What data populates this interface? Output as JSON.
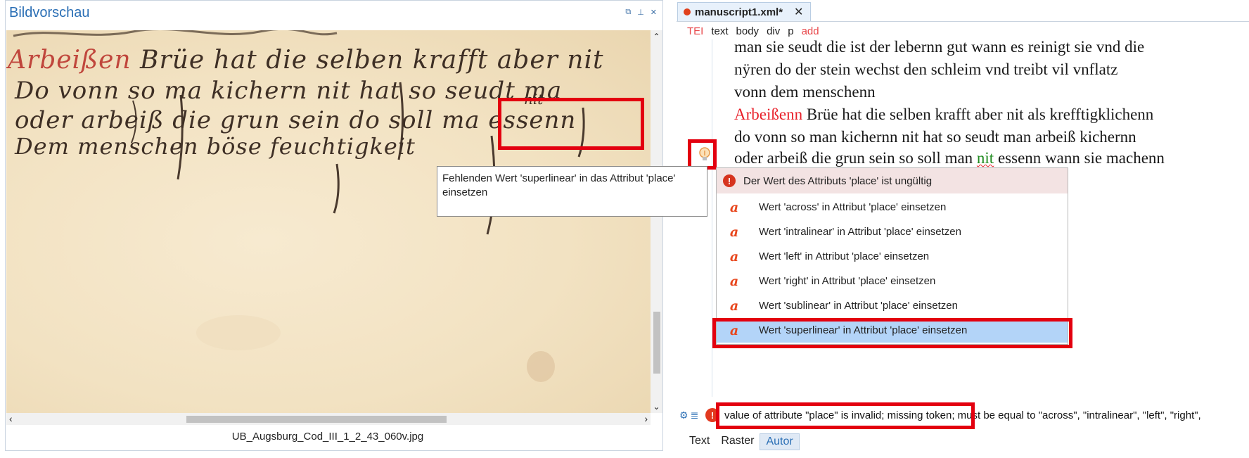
{
  "left_panel": {
    "title": "Bildvorschau",
    "controls": [
      "restore-icon",
      "pin-icon",
      "close-icon"
    ],
    "image_caption": "UB_Augsburg_Cod_III_1_2_43_060v.jpg",
    "manuscript_lines": [
      "Arbeißen Brüe hat die selben krafft aber nit",
      "Do vonn so ma kichern nit hat so seudt ma",
      "oder arbeiß die grun sein do soll ma essenn",
      "Dem menschen böse feuchtigkeit"
    ],
    "interlinear_note": "nit"
  },
  "editor": {
    "tab_label": "manuscript1.xml*",
    "breadcrumb": [
      "TEI",
      "text",
      "body",
      "div",
      "p",
      "add"
    ],
    "lines": {
      "l1": "man sie seudt die ist der lebernn gut wann es reinigt sie vnd die",
      "l2": "nÿren do der stein wechst den schleim vnd treibt vil vnflatz",
      "l3": "vonn dem menschenn",
      "l4_red": "Arbeißenn",
      "l4_rest": " Brüe hat die selben krafft aber nit als krefftigklichenn",
      "l5": "do vonn so man kichernn nit hat so seudt man arbeiß kichernn",
      "l6_pre": "oder arbeiß die grun sein so soll man ",
      "l6_green": "nit",
      "l6_post": " essenn wann sie machenn"
    }
  },
  "tooltip": {
    "text": "Fehlenden Wert 'superlinear' in das Attribut 'place' einsetzen"
  },
  "quickfix": {
    "header": "Der Wert des Attributs 'place' ist ungültig",
    "items": [
      "Wert 'across' in Attribut 'place' einsetzen",
      "Wert 'intralinear' in Attribut 'place' einsetzen",
      "Wert 'left' in Attribut 'place' einsetzen",
      "Wert 'right' in Attribut 'place' einsetzen",
      "Wert 'sublinear' in Attribut 'place' einsetzen",
      "Wert 'superlinear' in Attribut 'place' einsetzen"
    ],
    "selected_index": 5
  },
  "status": {
    "message_highlighted": "value of attribute \"place\" is invalid; missing token;",
    "message_rest": " must be equal to \"across\", \"intralinear\", \"left\", \"right\","
  },
  "mode_tabs": [
    "Text",
    "Raster",
    "Autor"
  ],
  "active_mode": "Autor",
  "colors": {
    "highlight": "#e3000f",
    "accent": "#2b6fb5",
    "error": "#e2391f",
    "selection": "#b3d4f8"
  }
}
